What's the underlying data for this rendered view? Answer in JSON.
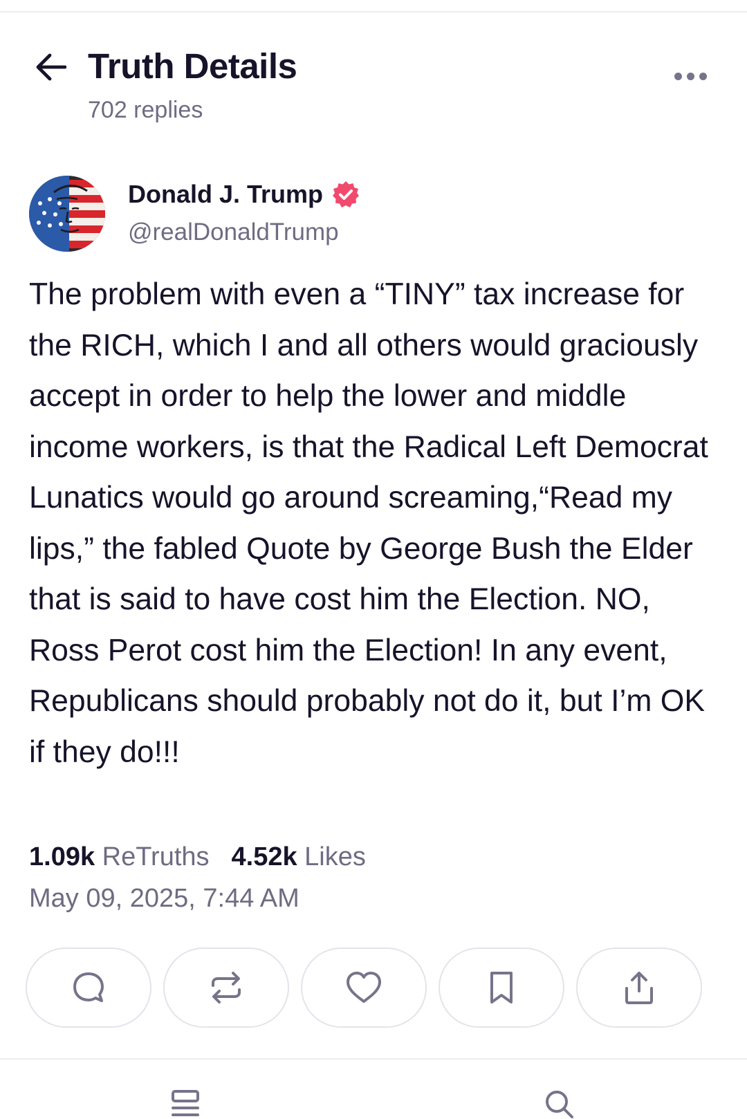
{
  "header": {
    "title": "Truth Details",
    "replies": "702 replies",
    "back_icon": "arrow-left-icon",
    "more_icon": "more-horizontal-icon"
  },
  "post": {
    "author_name": "Donald J. Trump",
    "author_handle": "@realDonaldTrump",
    "verified_icon": "verified-badge-icon",
    "text": "The problem with even a “TINY” tax increase for the RICH, which I and all others would graciously accept in order to help the lower and middle income workers, is that the Radical Left Democrat Lunatics would go around screaming,“Read my lips,” the fabled Quote by George Bush the Elder that is said to have cost him the Election. NO, Ross Perot cost him the Election! In any event, Republicans should probably not do it, but I’m OK if they do!!!",
    "retruths_count": "1.09k",
    "retruths_label": "ReTruths",
    "likes_count": "4.52k",
    "likes_label": "Likes",
    "timestamp": "May 09, 2025, 7:44 AM"
  },
  "actions": [
    {
      "name": "reply-button",
      "icon": "comment-icon"
    },
    {
      "name": "retruth-button",
      "icon": "repeat-icon"
    },
    {
      "name": "like-button",
      "icon": "heart-icon"
    },
    {
      "name": "bookmark-button",
      "icon": "bookmark-icon"
    },
    {
      "name": "share-button",
      "icon": "share-icon"
    }
  ],
  "bottom_nav": [
    {
      "name": "nav-feed",
      "icon": "feed-icon"
    },
    {
      "name": "nav-search",
      "icon": "search-icon"
    }
  ],
  "colors": {
    "text": "#17132a",
    "muted": "#6f6b82",
    "verified": "#f04a6d",
    "border": "#e4e3ea"
  }
}
